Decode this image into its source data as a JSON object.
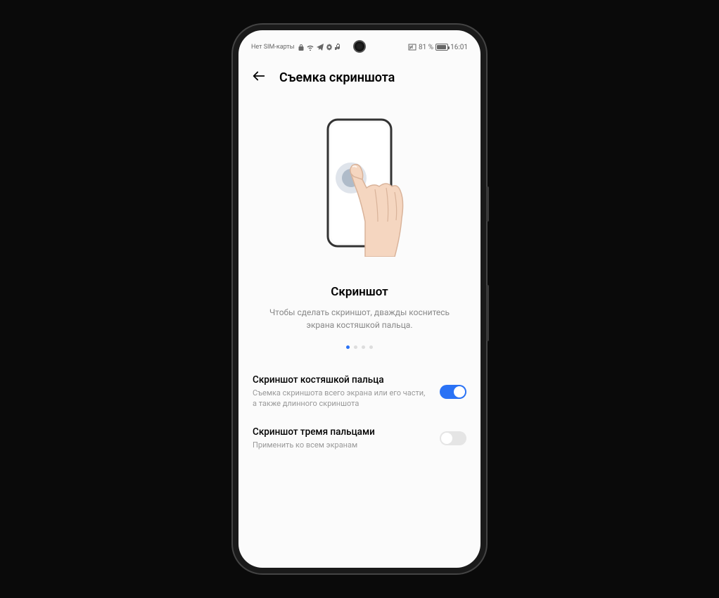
{
  "statusBar": {
    "simLabel": "Нет SIM-карты",
    "batteryPercent": "81 %",
    "time": "16:01"
  },
  "header": {
    "title": "Съемка скриншота"
  },
  "feature": {
    "title": "Скриншот",
    "description": "Чтобы сделать скриншот, дважды коснитесь экрана костяшкой пальца."
  },
  "pager": {
    "total": 4,
    "activeIndex": 0
  },
  "settings": [
    {
      "title": "Скриншот костяшкой пальца",
      "subtitle": "Съемка скриншота всего экрана или его части, а также длинного скриншота",
      "enabled": true
    },
    {
      "title": "Скриншот тремя пальцами",
      "subtitle": "Применить ко всем экранам",
      "enabled": false
    }
  ]
}
